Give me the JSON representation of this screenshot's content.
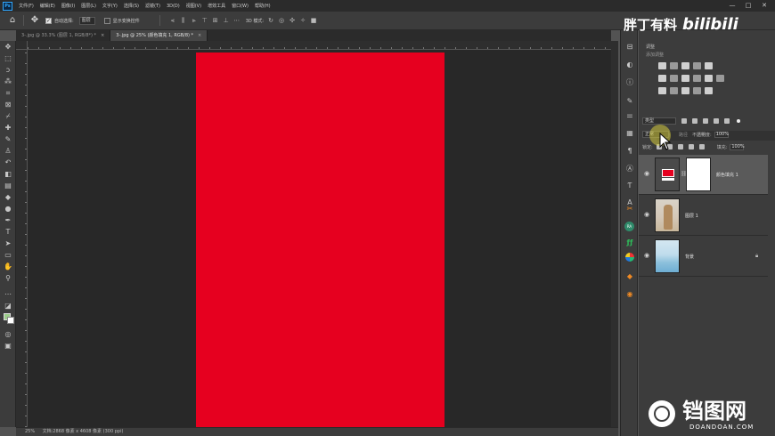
{
  "app": {
    "logo_text": "Ps",
    "menu": [
      "文件(F)",
      "编辑(E)",
      "图像(I)",
      "图层(L)",
      "文字(Y)",
      "选择(S)",
      "滤镜(T)",
      "3D(D)",
      "视图(V)",
      "增效工具",
      "窗口(W)",
      "帮助(H)"
    ],
    "window_controls": {
      "minimize": "—",
      "maximize": "□",
      "close": "✕"
    }
  },
  "options": {
    "auto_select_label": "自动选择:",
    "auto_select_target": "图层",
    "transform_controls_label": "显示变换控件",
    "three_d_label": "3D 模式:"
  },
  "tabs": [
    {
      "label": "3-.jpg @ 33.3% (图层 1, RGB/8*) *",
      "close": "×",
      "active": false
    },
    {
      "label": "3-.jpg @ 25% (颜色填充 1, RGB/8) *",
      "close": "×",
      "active": true
    }
  ],
  "canvas": {
    "fill_color": "#e6001f",
    "pasteboard_color": "#282828"
  },
  "status": {
    "zoom": "25%",
    "info": "文档:2868 像素 x 4608 像素 (300 ppi)"
  },
  "adjustments": {
    "title": "调整",
    "subtitle": "添加调整"
  },
  "layers_panel": {
    "tabs": [
      "图层",
      "通道",
      "路径",
      "历史"
    ],
    "active_tab": "图层",
    "filter_label": "类型",
    "blend_mode": "正常",
    "opacity_label": "不透明度:",
    "opacity_value": "100%",
    "lock_label": "锁定:",
    "fill_label": "填充:",
    "fill_value": "100%",
    "layers": [
      {
        "name": "颜色填充 1",
        "kind": "fill",
        "selected": true,
        "visible": true
      },
      {
        "name": "图层 1",
        "kind": "person",
        "selected": false,
        "visible": true
      },
      {
        "name": "背景",
        "kind": "sky",
        "selected": false,
        "visible": true,
        "locked": true
      }
    ]
  },
  "watermarks": {
    "top_text": "胖丁有料",
    "top_brand": "bilibili",
    "bottom_text": "铛图网",
    "bottom_sub": "DOANDOAN.COM"
  }
}
